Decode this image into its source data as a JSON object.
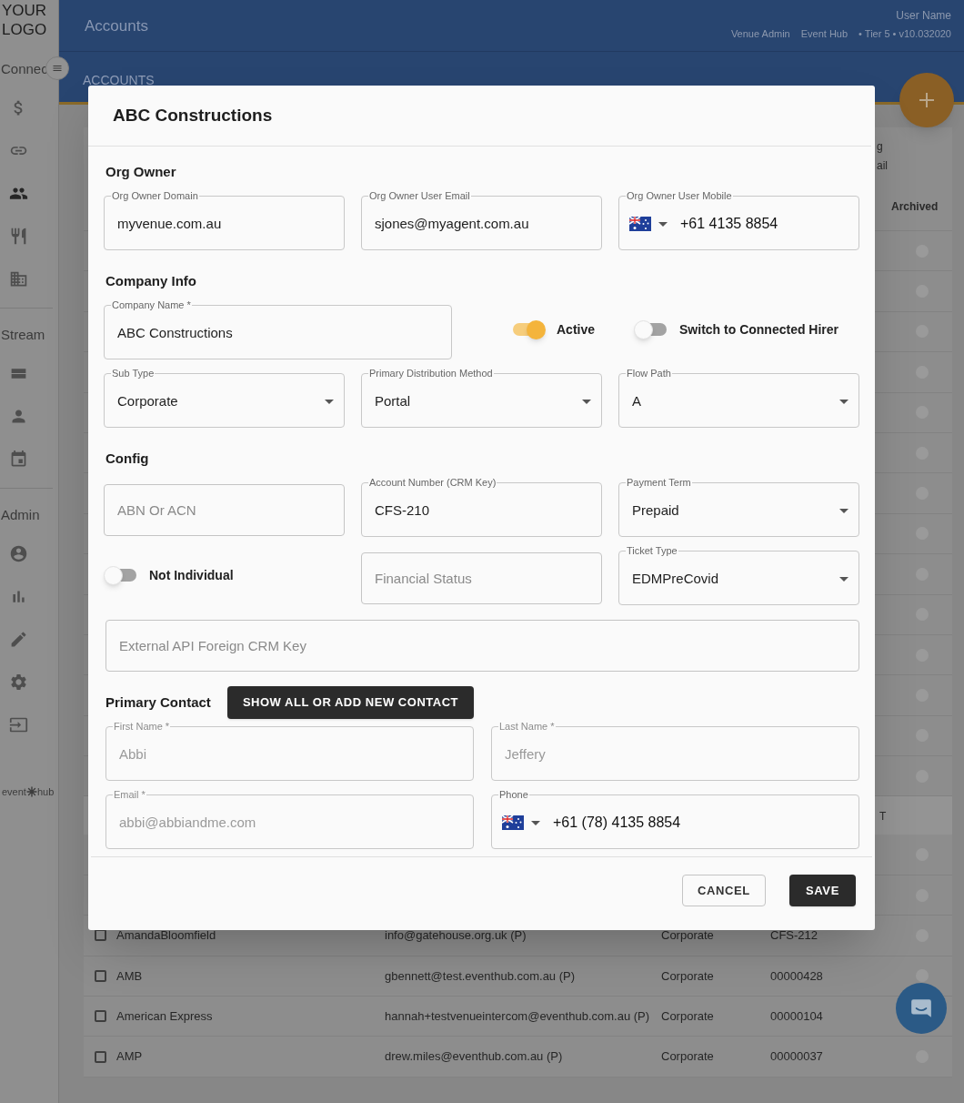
{
  "sidebar": {
    "logo": "YOUR LOGO",
    "sections": [
      {
        "title": "Connec",
        "items": [
          {
            "kind": "dollar",
            "selected": false
          },
          {
            "kind": "link",
            "selected": false
          },
          {
            "kind": "people",
            "selected": true
          },
          {
            "kind": "dining",
            "selected": false
          },
          {
            "kind": "building",
            "selected": false
          }
        ]
      },
      {
        "title": "Stream",
        "items": [
          {
            "kind": "rows",
            "selected": false
          },
          {
            "kind": "person",
            "selected": false
          },
          {
            "kind": "calendar",
            "selected": false
          }
        ]
      },
      {
        "title": "Admin",
        "items": [
          {
            "kind": "account",
            "selected": false
          },
          {
            "kind": "chart",
            "selected": false
          },
          {
            "kind": "pencil",
            "selected": false
          },
          {
            "kind": "gear",
            "selected": false
          },
          {
            "kind": "exit",
            "selected": false
          }
        ]
      }
    ],
    "brand": {
      "left": "event",
      "right": "hub"
    }
  },
  "header": {
    "title": "Accounts",
    "user_name": "User Name",
    "role": "Venue Admin",
    "org": "Event Hub",
    "meta": "• Tier 5 • v10.032020"
  },
  "tabs": [
    {
      "label": "ACCOUNTS",
      "selected": true
    }
  ],
  "table": {
    "partial_heading": [
      "g",
      "ail"
    ],
    "archived_heading": "Archived",
    "group_heading": "T",
    "rows": [
      {
        "checked": false,
        "name": "AmandaBloomfield",
        "email": "info@gatehouse.org.uk (P)",
        "type": "Corporate",
        "account": "CFS-212"
      },
      {
        "checked": false,
        "name": "AMB",
        "email": "gbennett@test.eventhub.com.au (P)",
        "type": "Corporate",
        "account": "00000428"
      },
      {
        "checked": false,
        "name": "American Express",
        "email": "hannah+testvenueintercom@eventhub.com.au (P)",
        "type": "Corporate",
        "account": "00000104"
      },
      {
        "checked": false,
        "name": "AMP",
        "email": "drew.miles@eventhub.com.au (P)",
        "type": "Corporate",
        "account": "00000037"
      }
    ]
  },
  "dialog": {
    "title": "ABC Constructions",
    "blocks": [
      {
        "kind": "heading",
        "text": "Org Owner"
      },
      {
        "kind": "row",
        "items": [
          {
            "kind": "text",
            "label": "Org Owner Domain",
            "value": "myvenue.com.au"
          },
          {
            "kind": "text",
            "label": "Org Owner User Email",
            "value": "sjones@myagent.com.au"
          },
          {
            "kind": "phone",
            "label": "Org Owner User Mobile",
            "value": "+61 4135 8854"
          }
        ]
      },
      {
        "kind": "heading",
        "text": "Company Info"
      },
      {
        "kind": "row",
        "items": [
          {
            "kind": "text",
            "label": "Company Name *",
            "value": "ABC Constructions"
          },
          {
            "kind": "toggle",
            "label": "Active",
            "on": true
          },
          {
            "kind": "toggle",
            "label": "Switch to Connected Hirer",
            "on": false
          }
        ]
      },
      {
        "kind": "row",
        "items": [
          {
            "kind": "select",
            "label": "Sub Type",
            "value": "Corporate"
          },
          {
            "kind": "select",
            "label": "Primary Distribution Method",
            "value": "Portal"
          },
          {
            "kind": "select",
            "label": "Flow Path",
            "value": "A"
          }
        ]
      },
      {
        "kind": "heading",
        "text": "Config"
      },
      {
        "kind": "row",
        "items": [
          {
            "kind": "text",
            "placeholder": "ABN Or ACN"
          },
          {
            "kind": "text",
            "label": "Account Number (CRM Key)",
            "value": "CFS-210"
          },
          {
            "kind": "select",
            "label": "Payment Term",
            "value": "Prepaid"
          }
        ]
      },
      {
        "kind": "row",
        "items": [
          {
            "kind": "toggle",
            "label": "Not Individual",
            "on": false
          },
          {
            "kind": "text",
            "placeholder": "Financial Status"
          },
          {
            "kind": "select",
            "label": "Ticket Type",
            "value": "EDMPreCovid"
          }
        ]
      },
      {
        "kind": "row",
        "items": [
          {
            "kind": "text",
            "placeholder": "External API Foreign CRM Key"
          }
        ]
      },
      {
        "kind": "heading",
        "text": "Primary Contact",
        "button": "SHOW ALL OR ADD NEW CONTACT"
      },
      {
        "kind": "row",
        "items": [
          {
            "kind": "text",
            "label": "First Name *",
            "value": "Abbi",
            "disabled": true
          },
          {
            "kind": "text",
            "label": "Last Name *",
            "value": "Jeffery",
            "disabled": true
          }
        ]
      },
      {
        "kind": "row",
        "items": [
          {
            "kind": "text",
            "label": "Email *",
            "value": "abbi@abbiandme.com",
            "disabled": true
          },
          {
            "kind": "phone",
            "label": "Phone",
            "value": "+61 (78) 4135 8854",
            "disabled": false
          }
        ]
      }
    ],
    "buttons": [
      {
        "kind": "outlined",
        "label": "CANCEL"
      },
      {
        "kind": "filled",
        "label": "SAVE"
      }
    ]
  }
}
